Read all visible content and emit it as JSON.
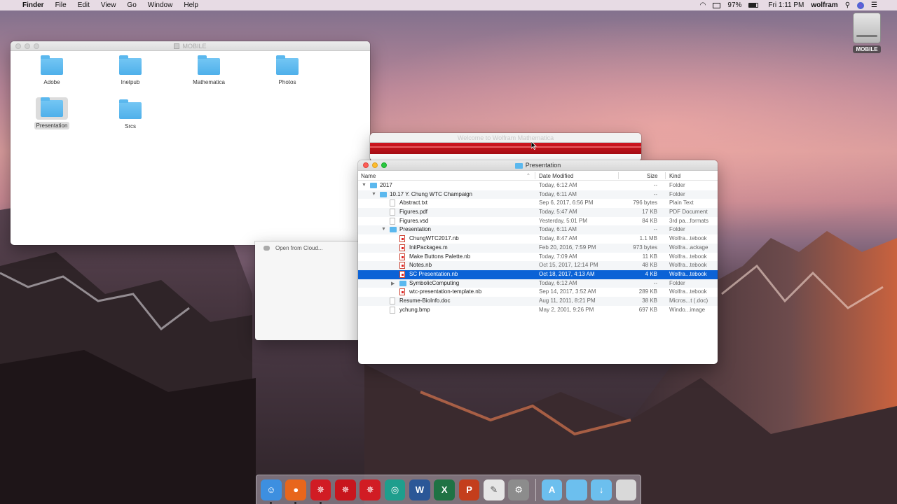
{
  "menubar": {
    "app": "Finder",
    "items": [
      "File",
      "Edit",
      "View",
      "Go",
      "Window",
      "Help"
    ],
    "battery": "97%",
    "clock": "Fri 1:11 PM",
    "user": "wolfram"
  },
  "desktop": {
    "drive_label": "MOBILE"
  },
  "mobile_window": {
    "title": "MOBILE",
    "items": [
      "Adobe",
      "Inetpub",
      "Mathematica",
      "Photos",
      "Presentation",
      "Srcs"
    ],
    "selected": "Presentation"
  },
  "welcome_window": {
    "title": "Welcome to Wolfram Mathematica"
  },
  "cloud_window": {
    "item": "Open from Cloud..."
  },
  "presentation_window": {
    "title": "Presentation",
    "columns": {
      "name": "Name",
      "date": "Date Modified",
      "size": "Size",
      "kind": "Kind"
    },
    "rows": [
      {
        "name": "2017",
        "date": "Today, 6:12 AM",
        "size": "--",
        "kind": "Folder",
        "indent": 0,
        "icon": "folder",
        "expand": "open"
      },
      {
        "name": "10.17 Y. Chung WTC Champaign",
        "date": "Today, 6:11 AM",
        "size": "--",
        "kind": "Folder",
        "indent": 1,
        "icon": "folder",
        "expand": "open"
      },
      {
        "name": "Abstract.txt",
        "date": "Sep 6, 2017, 6:56 PM",
        "size": "796 bytes",
        "kind": "Plain Text",
        "indent": 2,
        "icon": "doc",
        "expand": ""
      },
      {
        "name": "Figures.pdf",
        "date": "Today, 5:47 AM",
        "size": "17 KB",
        "kind": "PDF Document",
        "indent": 2,
        "icon": "doc",
        "expand": ""
      },
      {
        "name": "Figures.vsd",
        "date": "Yesterday, 5:01 PM",
        "size": "84 KB",
        "kind": "3rd pa...formats",
        "indent": 2,
        "icon": "doc",
        "expand": ""
      },
      {
        "name": "Presentation",
        "date": "Today, 6:11 AM",
        "size": "--",
        "kind": "Folder",
        "indent": 2,
        "icon": "folder",
        "expand": "open"
      },
      {
        "name": "ChungWTC2017.nb",
        "date": "Today, 8:47 AM",
        "size": "1.1 MB",
        "kind": "Wolfra...tebook",
        "indent": 3,
        "icon": "nb",
        "expand": ""
      },
      {
        "name": "InitPackages.m",
        "date": "Feb 20, 2016, 7:59 PM",
        "size": "973 bytes",
        "kind": "Wolfra...ackage",
        "indent": 3,
        "icon": "nb",
        "expand": ""
      },
      {
        "name": "Make Buttons Palette.nb",
        "date": "Today, 7:09 AM",
        "size": "11 KB",
        "kind": "Wolfra...tebook",
        "indent": 3,
        "icon": "nb",
        "expand": ""
      },
      {
        "name": "Notes.nb",
        "date": "Oct 15, 2017, 12:14 PM",
        "size": "48 KB",
        "kind": "Wolfra...tebook",
        "indent": 3,
        "icon": "nb",
        "expand": ""
      },
      {
        "name": "SC Presentation.nb",
        "date": "Oct 18, 2017, 4:13 AM",
        "size": "4 KB",
        "kind": "Wolfra...tebook",
        "indent": 3,
        "icon": "nb",
        "expand": "",
        "selected": true
      },
      {
        "name": "SymbolicComputing",
        "date": "Today, 6:12 AM",
        "size": "--",
        "kind": "Folder",
        "indent": 3,
        "icon": "folder",
        "expand": "closed"
      },
      {
        "name": "wtc-presentation-template.nb",
        "date": "Sep 14, 2017, 3:52 AM",
        "size": "289 KB",
        "kind": "Wolfra...tebook",
        "indent": 3,
        "icon": "nb",
        "expand": ""
      },
      {
        "name": "Resume-BioInfo.doc",
        "date": "Aug 11, 2011, 8:21 PM",
        "size": "38 KB",
        "kind": "Micros...t (.doc)",
        "indent": 2,
        "icon": "doc",
        "expand": ""
      },
      {
        "name": "ychung.bmp",
        "date": "May 2, 2001, 9:26 PM",
        "size": "697 KB",
        "kind": "Windo...image",
        "indent": 2,
        "icon": "doc",
        "expand": ""
      }
    ]
  },
  "dock": {
    "apps": [
      {
        "id": "finder-icon",
        "color": "#3d8fe0",
        "glyph": "☺"
      },
      {
        "id": "firefox-icon",
        "color": "#e8661c",
        "glyph": "●"
      },
      {
        "id": "mathematica-icon",
        "color": "#d11c24",
        "glyph": "✵"
      },
      {
        "id": "mathematica-alt-icon",
        "color": "#c8151d",
        "glyph": "✵"
      },
      {
        "id": "wolfram-player-icon",
        "color": "#d11c24",
        "glyph": "✵"
      },
      {
        "id": "system-modeler-icon",
        "color": "#1e9e8d",
        "glyph": "◎"
      },
      {
        "id": "word-icon",
        "color": "#2b5797",
        "glyph": "W"
      },
      {
        "id": "excel-icon",
        "color": "#1f7244",
        "glyph": "X"
      },
      {
        "id": "powerpoint-icon",
        "color": "#c43e1c",
        "glyph": "P"
      },
      {
        "id": "textedit-icon",
        "color": "#e6e6e6",
        "glyph": "✎"
      },
      {
        "id": "system-preferences-icon",
        "color": "#8c8c8c",
        "glyph": "⚙"
      }
    ],
    "stacks": [
      {
        "id": "applications-stack-icon",
        "color": "#6cbfee",
        "glyph": "A"
      },
      {
        "id": "documents-stack-icon",
        "color": "#6cbfee",
        "glyph": ""
      },
      {
        "id": "downloads-stack-icon",
        "color": "#6cbfee",
        "glyph": "↓"
      },
      {
        "id": "trash-icon",
        "color": "#d9d9d9",
        "glyph": ""
      }
    ]
  }
}
